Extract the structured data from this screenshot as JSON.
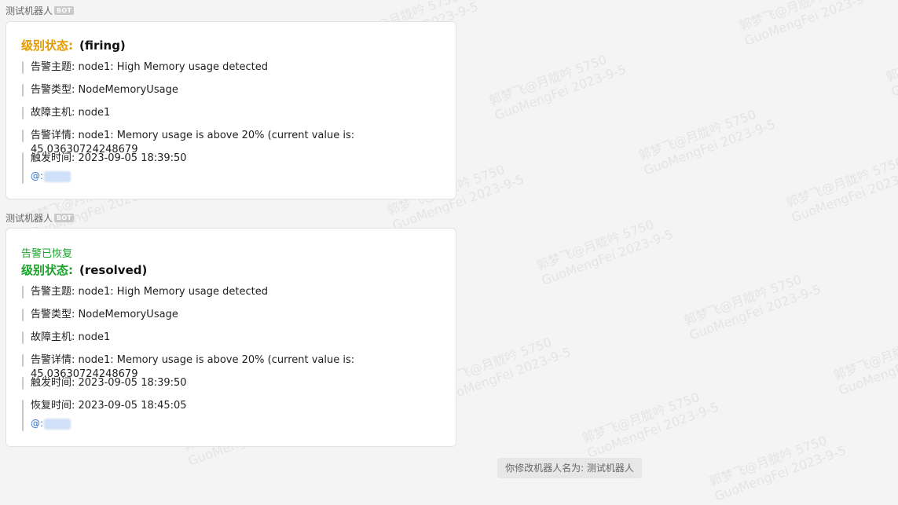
{
  "messages": [
    {
      "sender": "测试机器人",
      "badge": "BOT",
      "status_label": "级别状态:",
      "status_value": "(firing)",
      "rows": [
        "告警主题: node1: High Memory usage detected",
        "告警类型: NodeMemoryUsage",
        "故障主机: node1",
        "告警详情: node1: Memory usage is above 20% (current value is: 45.03630724248679",
        "触发时间: 2023-09-05 18:39:50"
      ],
      "mention": "@:"
    },
    {
      "sender": "测试机器人",
      "badge": "BOT",
      "recovered": "告警已恢复",
      "status_label": "级别状态:",
      "status_value": "(resolved)",
      "rows": [
        "告警主题: node1: High Memory usage detected",
        "告警类型: NodeMemoryUsage",
        "故障主机: node1",
        "告警详情: node1: Memory usage is above 20% (current value is: 45.03630724248679",
        "触发时间: 2023-09-05 18:39:50",
        "恢复时间: 2023-09-05 18:45:05"
      ],
      "mention": "@:"
    }
  ],
  "system_note": "你修改机器人名为: 测试机器人",
  "watermark": {
    "line1": "郭梦飞@月胧吟 5750",
    "line2": "GuoMengFei 2023-9-5"
  },
  "colors": {
    "firing": "#e29a00",
    "resolved": "#1aa32a",
    "mention": "#2e72d2",
    "background": "#f4f4f4"
  }
}
